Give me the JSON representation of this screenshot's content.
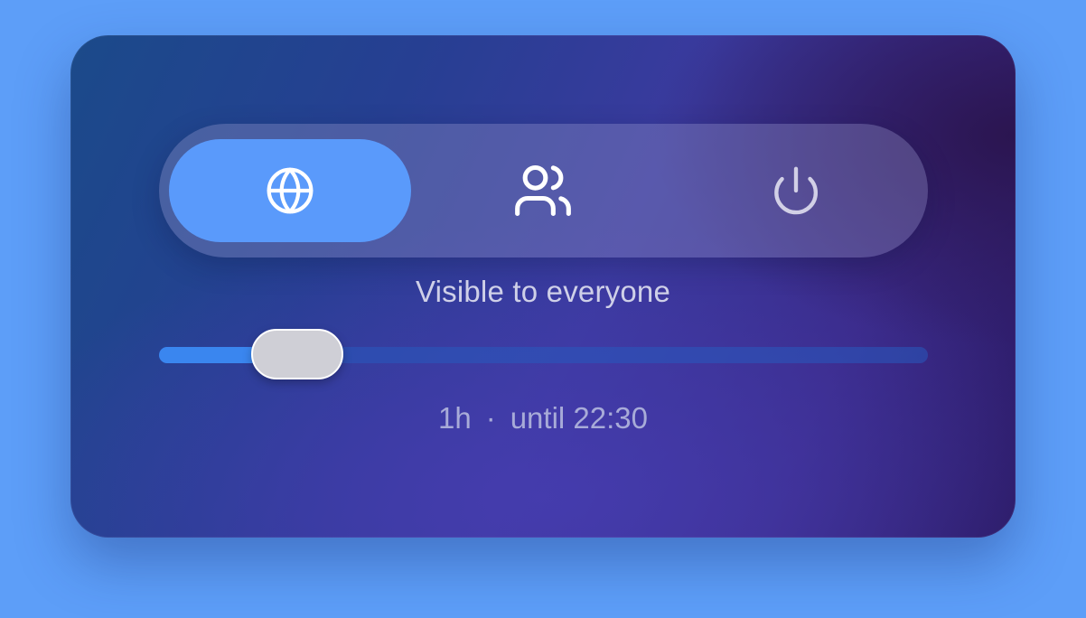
{
  "visibility": {
    "options": [
      {
        "id": "everyone",
        "icon": "globe-icon",
        "active": true
      },
      {
        "id": "contacts",
        "icon": "users-icon",
        "active": false
      },
      {
        "id": "off",
        "icon": "power-icon",
        "active": false
      }
    ],
    "status_label": "Visible to everyone"
  },
  "duration": {
    "value_fraction": 0.18,
    "length_label": "1h",
    "separator": "·",
    "until_label": "until 22:30"
  },
  "colors": {
    "accent": "#5a9afb",
    "slider_fill": "#3a86ef",
    "background": "#5d9ef8"
  }
}
